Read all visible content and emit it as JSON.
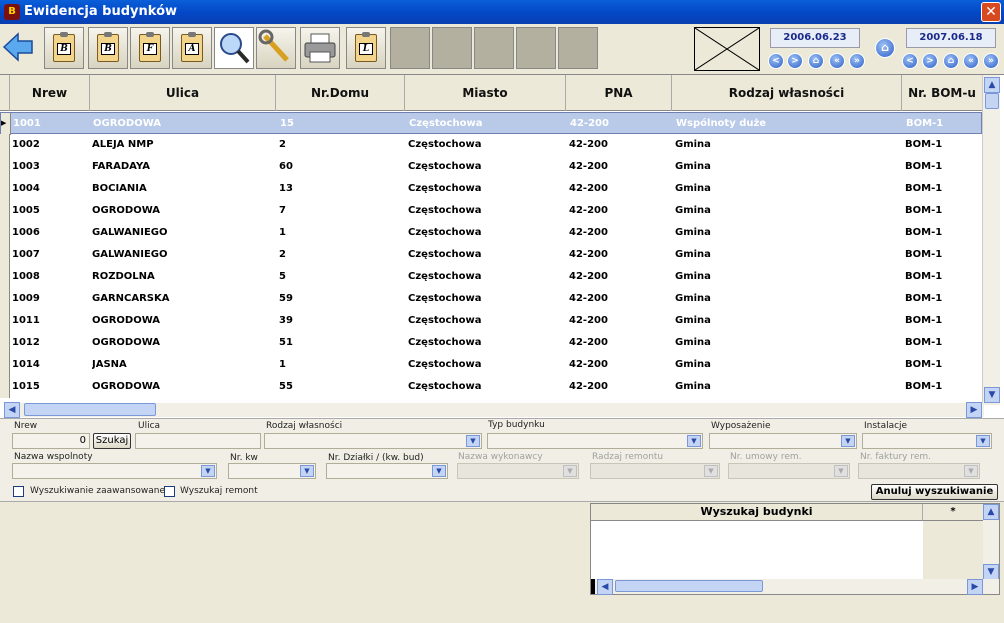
{
  "window": {
    "title": "Ewidencja budynków",
    "close_label": "✕"
  },
  "toolbar": {
    "back_icon": "arrow-left-icon",
    "buttons": [
      {
        "name": "report-b-button",
        "glyph": "B"
      },
      {
        "name": "report-paste-b-button",
        "glyph": "B"
      },
      {
        "name": "report-f-button",
        "glyph": "F"
      },
      {
        "name": "report-a-button",
        "glyph": "A"
      },
      {
        "name": "search-button",
        "glyph": "search-icon"
      },
      {
        "name": "tools-button",
        "glyph": "wrench-icon"
      },
      {
        "name": "print-button",
        "glyph": "printer-icon"
      },
      {
        "name": "report-l-button",
        "glyph": "L"
      }
    ],
    "date_from": "2006.06.23",
    "date_to": "2007.06.18",
    "home_icon": "home-icon"
  },
  "grid": {
    "columns": [
      "Nrew",
      "Ulica",
      "Nr.Domu",
      "Miasto",
      "PNA",
      "Rodzaj własności",
      "Nr. BOM-u"
    ],
    "rows": [
      [
        "1001",
        "OGRODOWA",
        "15",
        "Częstochowa",
        "42-200",
        "Wspólnoty duże",
        "BOM-1"
      ],
      [
        "1002",
        "ALEJA NMP",
        "2",
        "Częstochowa",
        "42-200",
        "Gmina",
        "BOM-1"
      ],
      [
        "1003",
        "FARADAYA",
        "60",
        "Częstochowa",
        "42-200",
        "Gmina",
        "BOM-1"
      ],
      [
        "1004",
        "BOCIANIA",
        "13",
        "Częstochowa",
        "42-200",
        "Gmina",
        "BOM-1"
      ],
      [
        "1005",
        "OGRODOWA",
        "7",
        "Częstochowa",
        "42-200",
        "Gmina",
        "BOM-1"
      ],
      [
        "1006",
        "GALWANIEGO",
        "1",
        "Częstochowa",
        "42-200",
        "Gmina",
        "BOM-1"
      ],
      [
        "1007",
        "GALWANIEGO",
        "2",
        "Częstochowa",
        "42-200",
        "Gmina",
        "BOM-1"
      ],
      [
        "1008",
        "ROZDOLNA",
        "5",
        "Częstochowa",
        "42-200",
        "Gmina",
        "BOM-1"
      ],
      [
        "1009",
        "GARNCARSKA",
        "59",
        "Częstochowa",
        "42-200",
        "Gmina",
        "BOM-1"
      ],
      [
        "1011",
        "OGRODOWA",
        "39",
        "Częstochowa",
        "42-200",
        "Gmina",
        "BOM-1"
      ],
      [
        "1012",
        "OGRODOWA",
        "51",
        "Częstochowa",
        "42-200",
        "Gmina",
        "BOM-1"
      ],
      [
        "1014",
        "JASNA",
        "1",
        "Częstochowa",
        "42-200",
        "Gmina",
        "BOM-1"
      ],
      [
        "1015",
        "OGRODOWA",
        "55",
        "Częstochowa",
        "42-200",
        "Gmina",
        "BOM-1"
      ]
    ],
    "selected_row": 0
  },
  "filters": {
    "nrew_label": "Nrew",
    "nrew_value": "0",
    "search_btn": "Szukaj",
    "ulica_label": "Ulica",
    "rodzaj_label": "Rodzaj własności",
    "typ_label": "Typ budynku",
    "wyposazenie_label": "Wyposażenie",
    "instalacje_label": "Instalacje",
    "wspolnoty_label": "Nazwa wspolnoty",
    "nrkw_label": "Nr. kw",
    "dzialki_label": "Nr. Działki / (kw. bud)",
    "wykonawcy_label": "Nazwa wykonawcy",
    "remontu_label": "Radzaj remontu",
    "umowy_label": "Nr. umowy rem.",
    "faktury_label": "Nr. faktury rem.",
    "advanced_label": "Wyszukiwanie zaawansowane",
    "remont_label": "Wyszukaj remont",
    "cancel_btn": "Anuluj wyszukiwanie"
  },
  "results": {
    "header": "Wyszukaj budynki",
    "star": "*"
  }
}
